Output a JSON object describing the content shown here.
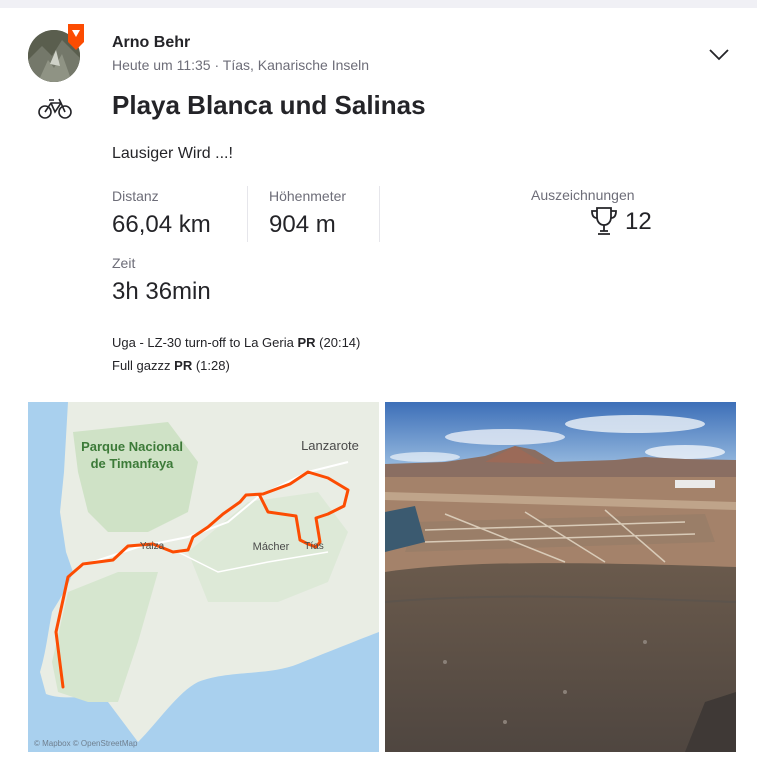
{
  "athlete": {
    "name": "Arno Behr",
    "meta": "Heute um 11:35 · Tías, Kanarische Inseln"
  },
  "activity": {
    "title": "Playa Blanca und Salinas",
    "description": "Lausiger Wird ...!",
    "sport_icon": "bike-icon"
  },
  "stats": [
    {
      "label": "Distanz",
      "value": "66,04 km"
    },
    {
      "label": "Höhenmeter",
      "value": "904 m"
    },
    {
      "label": "Zeit",
      "value": "3h 36min"
    }
  ],
  "achievements": {
    "label": "Auszeichnungen",
    "count": "12",
    "icon": "trophy-icon"
  },
  "segments": [
    {
      "name": "Uga - LZ-30 turn-off to La Geria",
      "pr": "PR",
      "time": "(20:14)"
    },
    {
      "name": "Full gazzz",
      "pr": "PR",
      "time": "(1:28)"
    }
  ],
  "map": {
    "labels": {
      "park_line1": "Parque Nacional",
      "park_line2": "de Timanfaya",
      "island": "Lanzarote",
      "town1": "Mácher",
      "town2": "Tías",
      "town3": "Yaiza"
    },
    "attribution": "© Mapbox © OpenStreetMap"
  },
  "colors": {
    "route": "#fc4c02",
    "sea": "#a9d0ee",
    "land": "#e9ede4",
    "brand": "#fc4c02"
  }
}
